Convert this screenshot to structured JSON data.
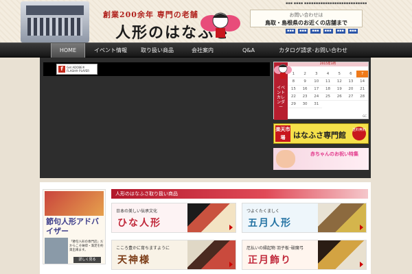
{
  "header": {
    "catchphrase": "創業200余年 専門の老舗",
    "logo": "人形のはなふさ",
    "contact_label": "お問い合わせは",
    "contact_text": "鳥取・島根県のお近くの店舗まで",
    "top_links": "▪▪▪ ▪▪▪▪ ▪▪▪▪▪▪▪▪▪▪▪▪▪▪▪▪▪▪▪▪▪▪▪▪▪▪▪",
    "blue_links": [
      "▪▪▪",
      "▪▪▪",
      "▪▪▪",
      "▪▪▪",
      "▪▪▪",
      "▪▪▪"
    ]
  },
  "nav": {
    "items": [
      "HOME",
      "イベント情報",
      "取り扱い商品",
      "会社案内",
      "Q&A",
      "カタログ請求･お問い合わせ"
    ]
  },
  "flash": {
    "line1": "Get ADOBE®",
    "line2": "FLASH® PLAYER"
  },
  "calendar": {
    "header": "2015年3月",
    "label": "イベントカレンダー",
    "weekdays": [
      "",
      "",
      "",
      "",
      "",
      "",
      ""
    ],
    "days": [
      "1",
      "2",
      "3",
      "4",
      "5",
      "6",
      "7",
      "8",
      "9",
      "10",
      "11",
      "12",
      "13",
      "14",
      "15",
      "16",
      "17",
      "18",
      "19",
      "20",
      "21",
      "22",
      "23",
      "24",
      "25",
      "26",
      "27",
      "28",
      "29",
      "30",
      "31"
    ],
    "today": "7",
    "footer": "GC"
  },
  "banner_rakuten": {
    "left": "楽天市場",
    "name": "はなふさ専門館",
    "ship": "送料無料"
  },
  "banner_baby": {
    "text": "赤ちゃんのお祝い特集"
  },
  "advisor": {
    "title": "節句人形アドバイザー",
    "text": "「節句人形の専門店」だからこそ納得・満足を約束出来ます。",
    "button": "詳しく見る"
  },
  "products": {
    "heading": "人形のはなふさ取り扱い商品",
    "items": [
      {
        "sub": "日本の美しい伝承文化",
        "title": "ひな人形"
      },
      {
        "sub": "つよくたくましく",
        "title": "五月人形"
      },
      {
        "sub": "こころ豊かに育ちますように",
        "title": "天神様"
      },
      {
        "sub": "厄払いの縁起物 羽子板･破魔弓",
        "title": "正月飾り"
      }
    ]
  },
  "colors": {
    "nav_bg": "#1f1f1f",
    "accent_red": "#b2172a",
    "calendar_today": "#ef7a1a",
    "dark_panel": "#2d2d2d"
  }
}
